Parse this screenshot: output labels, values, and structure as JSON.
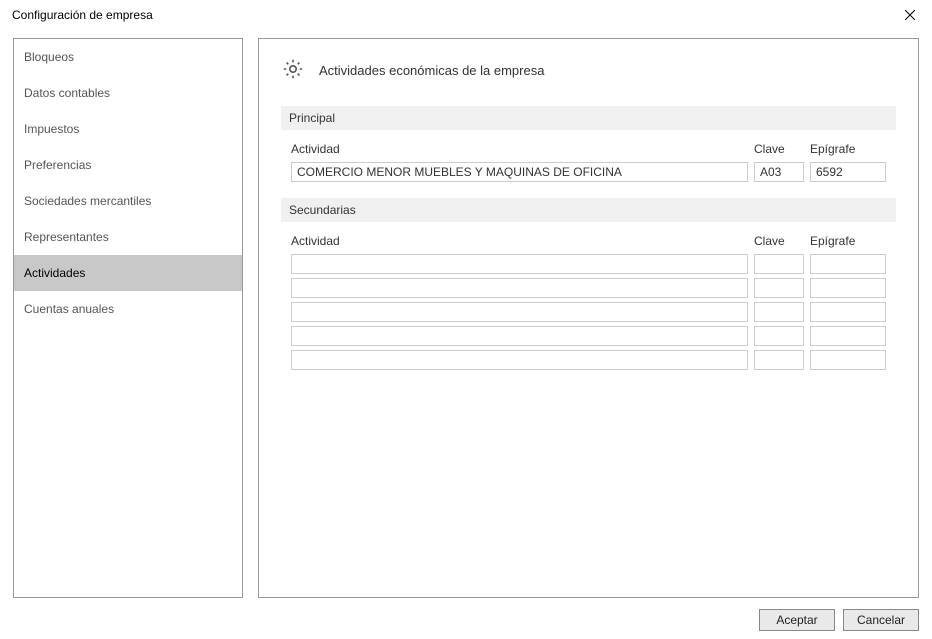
{
  "window": {
    "title": "Configuración de empresa"
  },
  "sidebar": {
    "items": [
      {
        "label": "Bloqueos"
      },
      {
        "label": "Datos contables"
      },
      {
        "label": "Impuestos"
      },
      {
        "label": "Preferencias"
      },
      {
        "label": "Sociedades mercantiles"
      },
      {
        "label": "Representantes"
      },
      {
        "label": "Actividades"
      },
      {
        "label": "Cuentas anuales"
      }
    ],
    "selected_index": 6
  },
  "main": {
    "header_title": "Actividades económicas de la empresa",
    "principal": {
      "section_label": "Principal",
      "columns": {
        "actividad": "Actividad",
        "clave": "Clave",
        "epigrafe": "Epígrafe"
      },
      "row": {
        "actividad": "COMERCIO MENOR MUEBLES Y MAQUINAS DE OFICINA",
        "clave": "A03",
        "epigrafe": "6592"
      }
    },
    "secundarias": {
      "section_label": "Secundarias",
      "columns": {
        "actividad": "Actividad",
        "clave": "Clave",
        "epigrafe": "Epígrafe"
      },
      "rows": [
        {
          "actividad": "",
          "clave": "",
          "epigrafe": ""
        },
        {
          "actividad": "",
          "clave": "",
          "epigrafe": ""
        },
        {
          "actividad": "",
          "clave": "",
          "epigrafe": ""
        },
        {
          "actividad": "",
          "clave": "",
          "epigrafe": ""
        },
        {
          "actividad": "",
          "clave": "",
          "epigrafe": ""
        }
      ]
    }
  },
  "footer": {
    "accept_label": "Aceptar",
    "cancel_label": "Cancelar"
  }
}
